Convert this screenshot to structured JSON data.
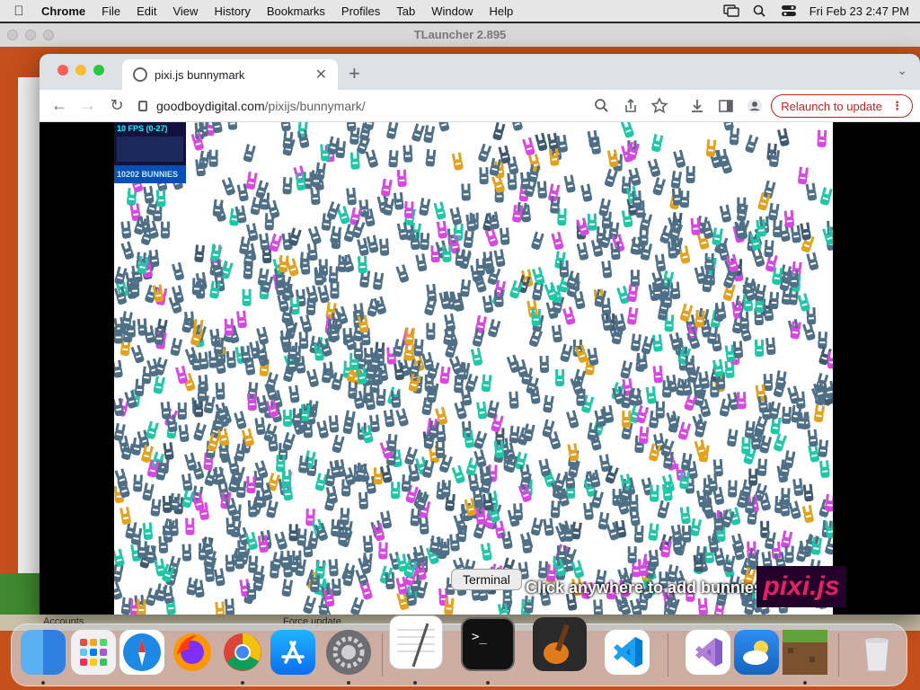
{
  "menubar": {
    "app": "Chrome",
    "items": [
      "File",
      "Edit",
      "View",
      "History",
      "Bookmarks",
      "Profiles",
      "Tab",
      "Window",
      "Help"
    ],
    "datetime": "Fri Feb 23  2:47 PM"
  },
  "background_window": {
    "title": "TLauncher 2.895",
    "bottom_labels": [
      "Accounts",
      "Force update"
    ]
  },
  "browser": {
    "tab_title": "pixi.js bunnymark",
    "url_host": "goodboydigital.com",
    "url_path": "/pixijs/bunnymark/",
    "relaunch_label": "Relaunch to update"
  },
  "page": {
    "fps_label": "10 FPS (0-27)",
    "bunny_count": "10202 BUNNIES",
    "call_to_action": "Click anywhere to add bunnies!",
    "logo_text": "pixi.js",
    "bunny_colors": [
      "#4e6f86",
      "#1fc7a6",
      "#d648e0",
      "#e0a21f",
      "#3f5a6e"
    ]
  },
  "tooltip": {
    "text": "Terminal"
  },
  "dock": {
    "apps": [
      "finder",
      "launchpad",
      "safari",
      "firefox",
      "chrome",
      "app-store",
      "system-settings",
      "textedit",
      "terminal",
      "garageband",
      "vscode",
      "visual-studio",
      "weather",
      "minecraft",
      "trash"
    ]
  },
  "colors": {
    "accent_red": "#c5221f",
    "tlauncher_orange": "#c64f1b",
    "tlauncher_green": "#3f8a2f"
  }
}
